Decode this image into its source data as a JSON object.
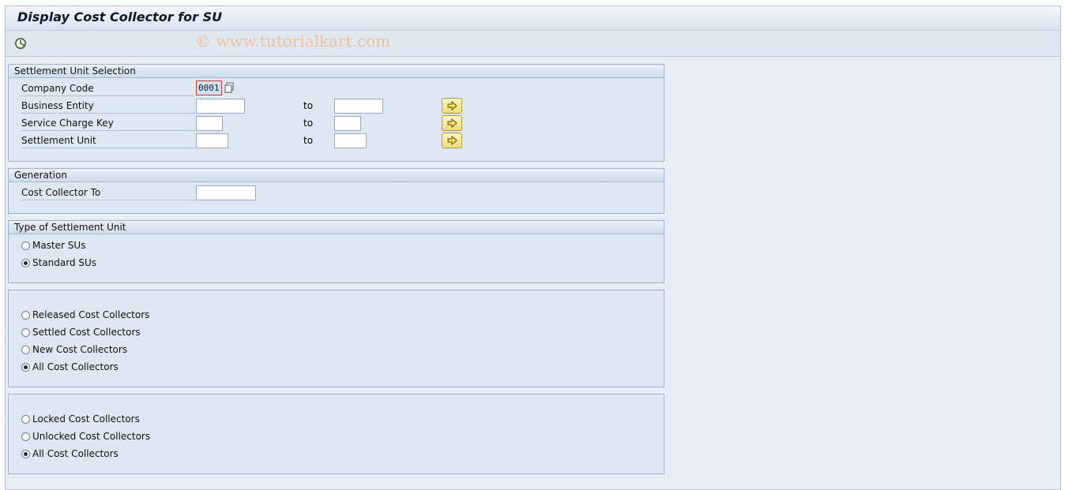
{
  "window": {
    "title": "Display Cost Collector for SU"
  },
  "toolbar": {
    "execute_icon": "execute-icon",
    "watermark": "© www.tutorialkart.com"
  },
  "settlement_unit_selection": {
    "header": "Settlement Unit Selection",
    "company_code": {
      "label": "Company Code",
      "value": "0001"
    },
    "business_entity": {
      "label": "Business Entity",
      "to": "to"
    },
    "service_charge_key": {
      "label": "Service Charge Key",
      "to": "to"
    },
    "settlement_unit": {
      "label": "Settlement Unit",
      "to": "to"
    }
  },
  "generation": {
    "header": "Generation",
    "cost_collector_to": {
      "label": "Cost Collector To"
    }
  },
  "type_of_su": {
    "header": "Type of Settlement Unit",
    "options": [
      {
        "label": "Master SUs",
        "selected": false
      },
      {
        "label": "Standard SUs",
        "selected": true
      }
    ]
  },
  "status_group": {
    "options": [
      {
        "label": "Released Cost Collectors",
        "selected": false
      },
      {
        "label": "Settled Cost Collectors",
        "selected": false
      },
      {
        "label": "New Cost Collectors",
        "selected": false
      },
      {
        "label": "All Cost Collectors",
        "selected": true
      }
    ]
  },
  "lock_group": {
    "options": [
      {
        "label": "Locked Cost Collectors",
        "selected": false
      },
      {
        "label": "Unlocked Cost Collectors",
        "selected": false
      },
      {
        "label": "All Cost Collectors",
        "selected": true
      }
    ]
  }
}
